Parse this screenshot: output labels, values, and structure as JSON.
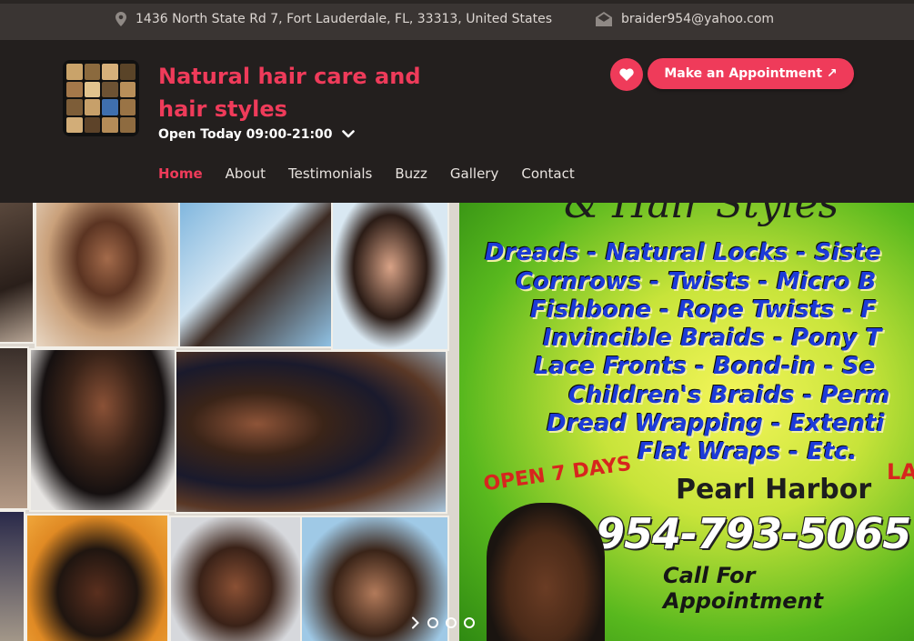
{
  "topbar": {
    "address": "1436 North State Rd 7, Fort Lauderdale, FL, 33313, United States",
    "email": "braider954@yahoo.com"
  },
  "header": {
    "title_line1": "Natural hair care and",
    "title_line2": "hair styles",
    "open_today": "Open Today 09:00-21:00",
    "appointment_label": "Make an Appointment ↗"
  },
  "nav": {
    "items": [
      "Home",
      "About",
      "Testimonials",
      "Buzz",
      "Gallery",
      "Contact"
    ],
    "active": "Home"
  },
  "flyer": {
    "lines": [
      "Dreads - Natural Locks - Siste",
      "Cornrows - Twists - Micro B",
      "Fishbone - Rope Twists - F",
      "Invincible Braids - Pony T",
      "Lace Fronts - Bond-in - Se",
      "Children's Braids - Perm",
      "Dread Wrapping - Extenti",
      "Flat Wraps - Etc."
    ],
    "open_days": "OPEN 7 DAYS",
    "location": "Pearl Harbor",
    "phone": "954-793-5065",
    "call_text": "Call For Appointment",
    "partial_right": "LA"
  },
  "colors": {
    "accent": "#ef3b5a",
    "header_bg": "#231f1e",
    "topbar_bg": "#3a3533"
  },
  "slider": {
    "slide_count": 3
  }
}
